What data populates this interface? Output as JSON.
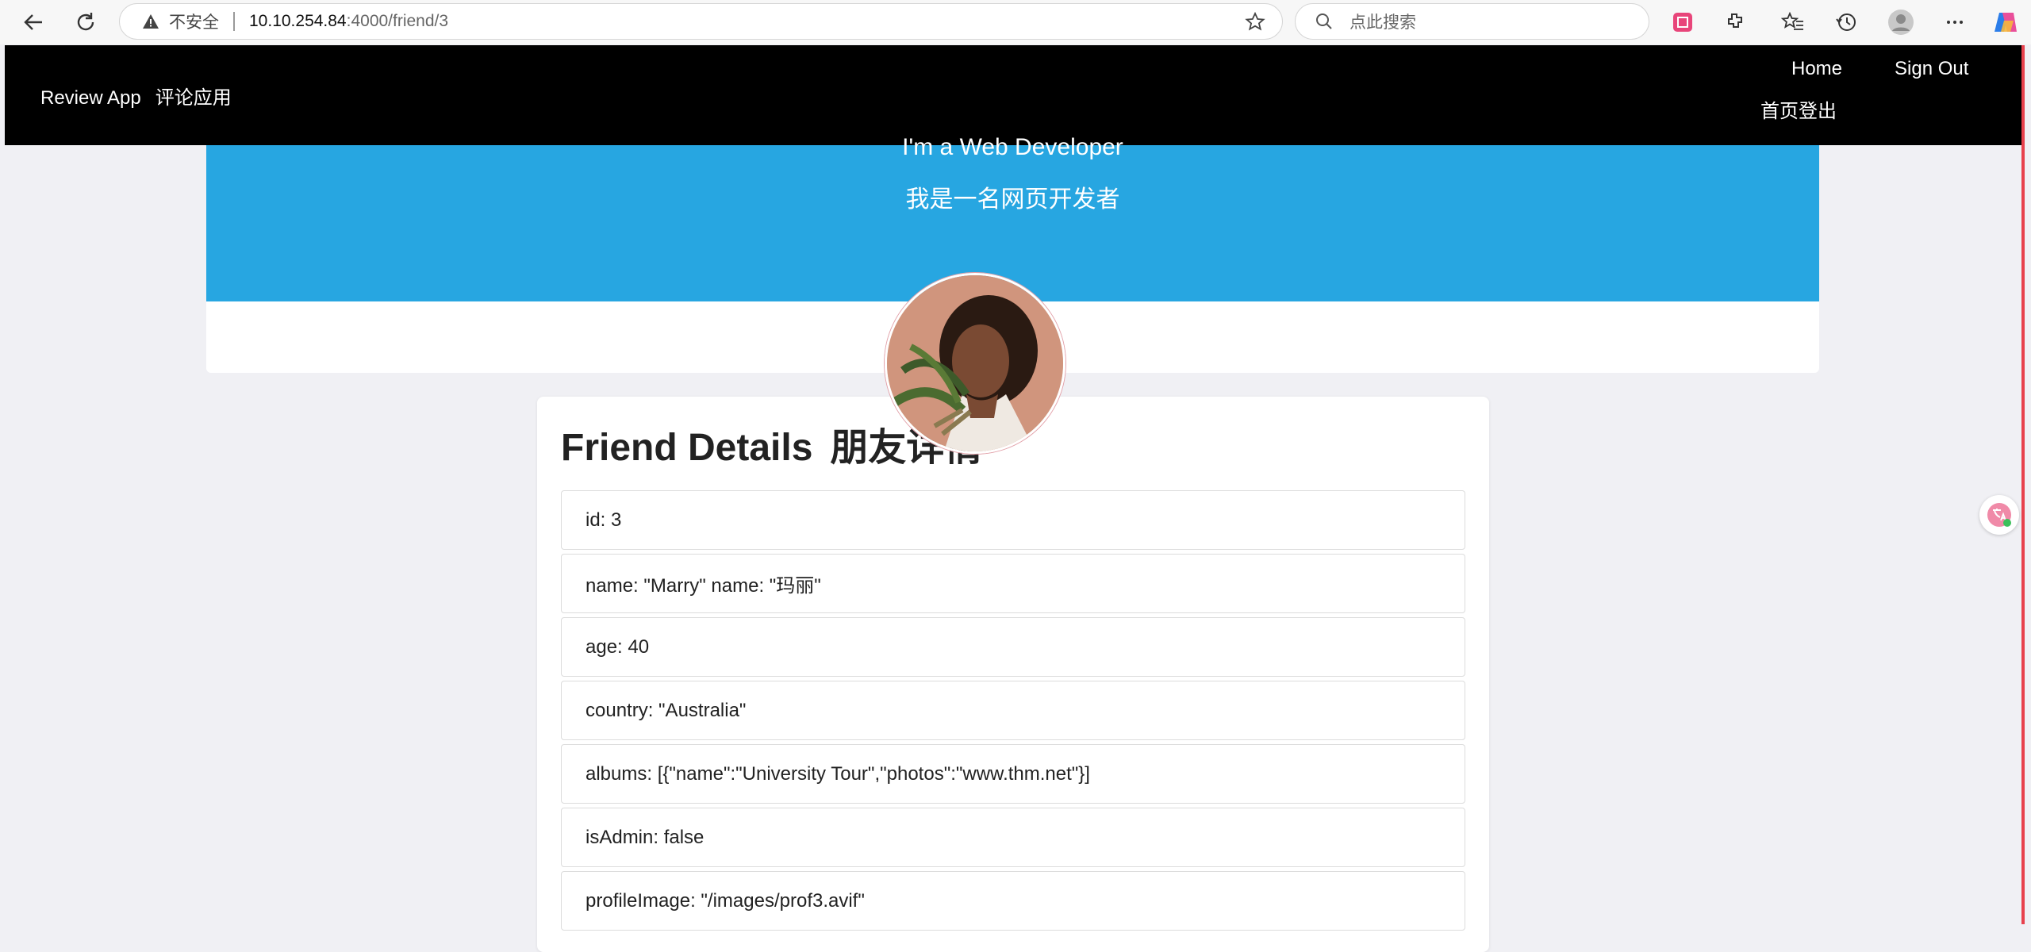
{
  "browser": {
    "not_secure": "不安全",
    "url_host": "10.10.254.84",
    "url_path": ":4000/friend/3",
    "search_placeholder": "点此搜索"
  },
  "navbar": {
    "brand": "Review App",
    "brand_cn": "评论应用",
    "home": "Home",
    "sign_out": "Sign Out",
    "cn_links": "首页登出"
  },
  "hero": {
    "line1": "I'm a Web Developer",
    "line2": "我是一名网页开发者"
  },
  "card": {
    "title": "Friend Details",
    "title_cn": "朋友详情",
    "fields": [
      "id: 3",
      "name: \"Marry\"   name: \"玛丽\"",
      "age: 40",
      "country: \"Australia\"",
      "albums: [{\"name\":\"University Tour\",\"photos\":\"www.thm.net\"}]",
      "isAdmin: false",
      "profileImage: \"/images/prof3.avif\""
    ]
  },
  "colors": {
    "hero_blue": "#27a6e1",
    "navbar_bg": "#000000",
    "edge_accent": "#e8414d"
  }
}
